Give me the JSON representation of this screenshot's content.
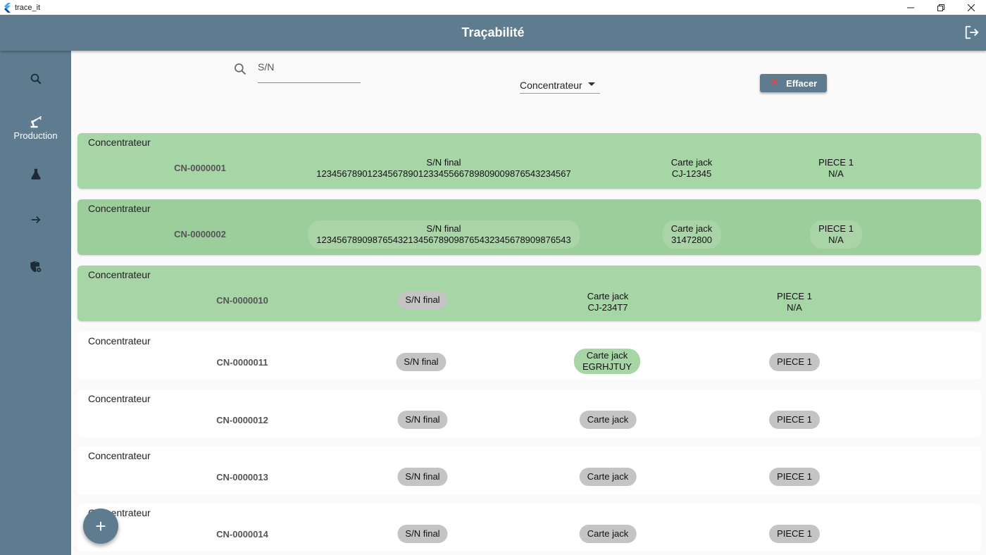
{
  "window": {
    "title": "trace_it",
    "controls": [
      "minimize",
      "restore",
      "close"
    ]
  },
  "appbar": {
    "title": "Traçabilité",
    "logout_icon": "logout-icon"
  },
  "sidebar": {
    "items": [
      {
        "icon": "search-icon",
        "label": ""
      },
      {
        "icon": "robot-arm-icon",
        "label": "Production"
      },
      {
        "icon": "flask-icon",
        "label": ""
      },
      {
        "icon": "arrow-right-icon",
        "label": ""
      },
      {
        "icon": "shield-icon",
        "label": ""
      }
    ]
  },
  "filters": {
    "search_placeholder": "S/N",
    "search_value": "",
    "type_selected": "Concentrateur",
    "clear_label": "Effacer"
  },
  "colors": {
    "primary": "#5e7b8f",
    "found_row": "#a6d5a6",
    "missing_chip": "#c4c4c4",
    "clear_icon": "#e8433c"
  },
  "rows": [
    {
      "type": "Concentrateur",
      "id": "CN-0000001",
      "status": "complete",
      "sn_final": {
        "title": "S/N final",
        "value": "12345678901234567890123345566789809009876543234567"
      },
      "carte_jack": {
        "title": "Carte jack",
        "value": "CJ-12345"
      },
      "piece1": {
        "title": "PIECE 1",
        "value": "N/A"
      }
    },
    {
      "type": "Concentrateur",
      "id": "CN-0000002",
      "status": "complete",
      "sn_final": {
        "title": "S/N final",
        "value": "12345678909876543213456789098765432345678909876543"
      },
      "carte_jack": {
        "title": "Carte jack",
        "value": "31472800"
      },
      "piece1": {
        "title": "PIECE 1",
        "value": "N/A"
      }
    },
    {
      "type": "Concentrateur",
      "id": "CN-0000010",
      "status": "complete",
      "sn_final": {
        "title": "S/N final",
        "value": ""
      },
      "carte_jack": {
        "title": "Carte jack",
        "value": "CJ-234T7"
      },
      "piece1": {
        "title": "PIECE 1",
        "value": "N/A"
      }
    },
    {
      "type": "Concentrateur",
      "id": "CN-0000011",
      "status": "partial",
      "sn_final": {
        "title": "S/N final",
        "value": ""
      },
      "carte_jack": {
        "title": "Carte jack",
        "value": "EGRHJTUY"
      },
      "piece1": {
        "title": "PIECE 1",
        "value": ""
      }
    },
    {
      "type": "Concentrateur",
      "id": "CN-0000012",
      "status": "empty",
      "sn_final": {
        "title": "S/N final",
        "value": ""
      },
      "carte_jack": {
        "title": "Carte jack",
        "value": ""
      },
      "piece1": {
        "title": "PIECE 1",
        "value": ""
      }
    },
    {
      "type": "Concentrateur",
      "id": "CN-0000013",
      "status": "empty",
      "sn_final": {
        "title": "S/N final",
        "value": ""
      },
      "carte_jack": {
        "title": "Carte jack",
        "value": ""
      },
      "piece1": {
        "title": "PIECE 1",
        "value": ""
      }
    },
    {
      "type": "Concentrateur",
      "id": "CN-0000014",
      "status": "empty",
      "sn_final": {
        "title": "S/N final",
        "value": ""
      },
      "carte_jack": {
        "title": "Carte jack",
        "value": ""
      },
      "piece1": {
        "title": "PIECE 1",
        "value": ""
      }
    }
  ],
  "fab": {
    "icon": "plus-icon",
    "label": "+"
  }
}
